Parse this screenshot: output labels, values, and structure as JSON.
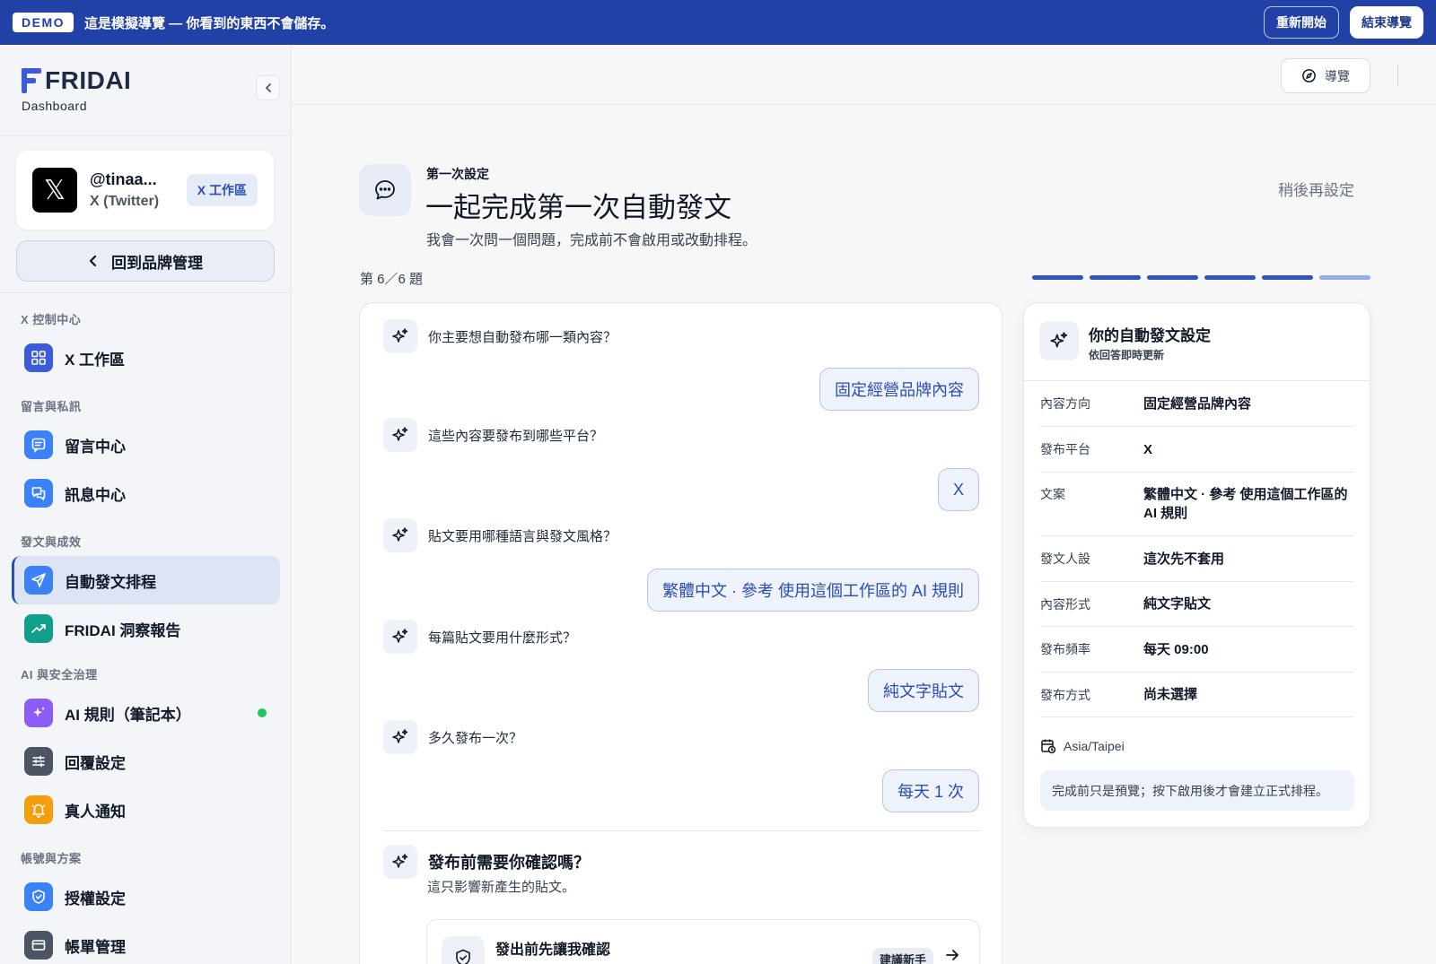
{
  "banner": {
    "badge": "DEMO",
    "text": "這是模擬導覽 — 你看到的東西不會儲存。",
    "restart_label": "重新開始",
    "end_label": "結束導覽",
    "bg_color": "#2141a6"
  },
  "brand": {
    "name": "FRIDAI",
    "subtitle": "Dashboard"
  },
  "account": {
    "handle": "@tinaa...",
    "platform": "X (Twitter)",
    "workspace_chip": "X 工作區"
  },
  "back_button": {
    "label": "回到品牌管理"
  },
  "nav": {
    "sections": [
      {
        "title": "X 控制中心",
        "items": [
          {
            "label": "X 工作區",
            "icon": "grid-icon",
            "color": "#3b5bdb"
          }
        ]
      },
      {
        "title": "留言與私訊",
        "items": [
          {
            "label": "留言中心",
            "icon": "comment-icon",
            "color": "#3b82f6"
          },
          {
            "label": "訊息中心",
            "icon": "messages-icon",
            "color": "#3b82f6"
          }
        ]
      },
      {
        "title": "發文與成效",
        "items": [
          {
            "label": "自動發文排程",
            "icon": "send-icon",
            "color": "#3b82f6",
            "active": true
          },
          {
            "label": "FRIDAI 洞察報告",
            "icon": "trend-icon",
            "color": "#0f9f8a"
          }
        ]
      },
      {
        "title": "AI 與安全治理",
        "items": [
          {
            "label": "AI 規則（筆記本）",
            "icon": "sparkle-icon",
            "color": "#8b5cf6",
            "status": "online"
          },
          {
            "label": "回覆設定",
            "icon": "sliders-icon",
            "color": "#4b5563"
          },
          {
            "label": "真人通知",
            "icon": "bell-icon",
            "color": "#f59e0b"
          }
        ]
      },
      {
        "title": "帳號與方案",
        "items": [
          {
            "label": "授權設定",
            "icon": "shield-icon",
            "color": "#3b82f6"
          },
          {
            "label": "帳單管理",
            "icon": "billing-icon",
            "color": "#4b5563"
          }
        ]
      }
    ]
  },
  "topbar": {
    "guide_label": "導覽"
  },
  "wizard": {
    "eyebrow": "第一次設定",
    "title": "一起完成第一次自動發文",
    "description": "我會一次問一個問題，完成前不會啟用或改動排程。",
    "later_link": "稍後再設定",
    "step_label": "第 6／6 題",
    "progress": {
      "current": 6,
      "total": 6
    }
  },
  "chat": {
    "turns": [
      {
        "question": "你主要想自動發布哪一類內容？",
        "answer": "固定經營品牌內容"
      },
      {
        "question": "這些內容要發布到哪些平台？",
        "answer": "X"
      },
      {
        "question": "貼文要用哪種語言與發文風格？",
        "answer": "繁體中文 · 參考 使用這個工作區的 AI 規則"
      },
      {
        "question": "每篇貼文要用什麼形式？",
        "answer": "純文字貼文"
      },
      {
        "question": "多久發布一次？",
        "answer": "每天 1 次"
      }
    ],
    "current_question": {
      "title": "發布前需要你確認嗎？",
      "subtitle": "這只影響新產生的貼文。",
      "option": {
        "title": "發出前先讓我確認",
        "badge": "建議新手"
      }
    }
  },
  "settings": {
    "title": "你的自動發文設定",
    "subtitle": "依回答即時更新",
    "rows": [
      {
        "key": "內容方向",
        "value": "固定經營品牌內容"
      },
      {
        "key": "發布平台",
        "value": "X"
      },
      {
        "key": "文案",
        "value": "繁體中文 · 參考 使用這個工作區的 AI 規則"
      },
      {
        "key": "發文人設",
        "value": "這次先不套用"
      },
      {
        "key": "內容形式",
        "value": "純文字貼文"
      },
      {
        "key": "發布頻率",
        "value": "每天 09:00"
      },
      {
        "key": "發布方式",
        "value": "尚未選擇"
      }
    ],
    "timezone": "Asia/Taipei",
    "note": "完成前只是預覽；按下啟用後才會建立正式排程。"
  }
}
